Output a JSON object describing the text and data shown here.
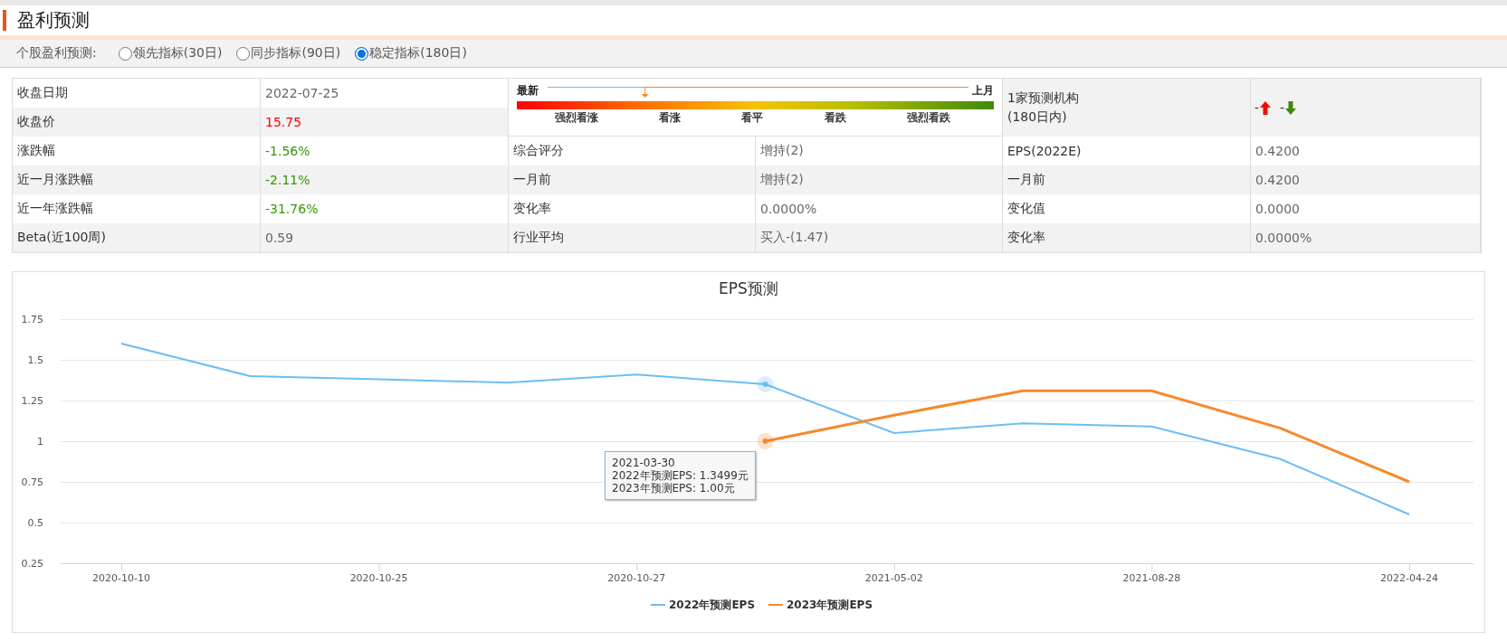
{
  "header": {
    "title": "盈利预测"
  },
  "radios": {
    "label": "个股盈利预测:",
    "items": [
      {
        "label": "领先指标(30日)",
        "selected": false
      },
      {
        "label": "同步指标(90日)",
        "selected": false
      },
      {
        "label": "稳定指标(180日)",
        "selected": true
      }
    ]
  },
  "stock": {
    "rows": [
      {
        "label": "收盘日期",
        "value": "2022-07-25",
        "color": "#666666"
      },
      {
        "label": "收盘价",
        "value": "15.75",
        "color": "#ff0000"
      },
      {
        "label": "涨跌幅",
        "value": "-1.56%",
        "color": "#339900"
      },
      {
        "label": "近一月涨跌幅",
        "value": "-2.11%",
        "color": "#339900"
      },
      {
        "label": "近一年涨跌幅",
        "value": "-31.76%",
        "color": "#339900"
      },
      {
        "label": "Beta(近100周)",
        "value": "0.59",
        "color": "#666666"
      }
    ]
  },
  "rating": {
    "gauge": {
      "left_label": "最新",
      "right_label": "上月",
      "level": 0.27,
      "scale_labels": [
        "强烈看涨",
        "看涨",
        "看平",
        "看跌",
        "强烈看跌"
      ]
    },
    "rows": [
      {
        "label": "综合评分",
        "value": "增持(2)"
      },
      {
        "label": "一月前",
        "value": "增持(2)"
      },
      {
        "label": "变化率",
        "value": "0.0000%"
      },
      {
        "label": "行业平均",
        "value": "买入-(1.47)"
      }
    ]
  },
  "forecast": {
    "header_lines": [
      "1家预测机构",
      "(180日内)"
    ],
    "changes": [
      {
        "kind": "up",
        "text": "-"
      },
      {
        "kind": "down",
        "text": "-"
      }
    ],
    "rows": [
      {
        "label": "EPS(2022E)",
        "value": "0.4200"
      },
      {
        "label": "一月前",
        "value": "0.4200"
      },
      {
        "label": "变化值",
        "value": "0.0000"
      },
      {
        "label": "变化率",
        "value": "0.0000%"
      }
    ]
  },
  "chart": {
    "chart_data": {
      "type": "line",
      "title": "EPS预测",
      "categories": [
        "2020-10-10",
        null,
        "2020-10-25",
        null,
        "2020-10-27",
        null,
        "2021-05-02",
        null,
        "2021-08-28",
        null,
        "2022-04-24"
      ],
      "grid": true,
      "legend": true,
      "ylim": [
        0.25,
        1.75
      ],
      "yticks": [
        0.25,
        0.5,
        0.75,
        1,
        1.25,
        1.5,
        1.75
      ],
      "series": [
        {
          "name": "2022年预测EPS",
          "color": "#6cbdf5",
          "values": [
            1.6,
            1.4,
            1.38,
            1.36,
            1.41,
            1.35,
            1.05,
            1.11,
            1.09,
            0.89,
            0.55
          ]
        },
        {
          "name": "2023年预测EPS",
          "color": "#f7892b",
          "values": [
            null,
            null,
            null,
            null,
            null,
            1.0,
            1.16,
            1.31,
            1.31,
            1.08,
            0.75
          ]
        }
      ]
    },
    "tooltip": {
      "lines": [
        "2021-03-30",
        "2022年预测EPS: 1.3499元",
        "2023年预测EPS: 1.00元"
      ]
    }
  }
}
